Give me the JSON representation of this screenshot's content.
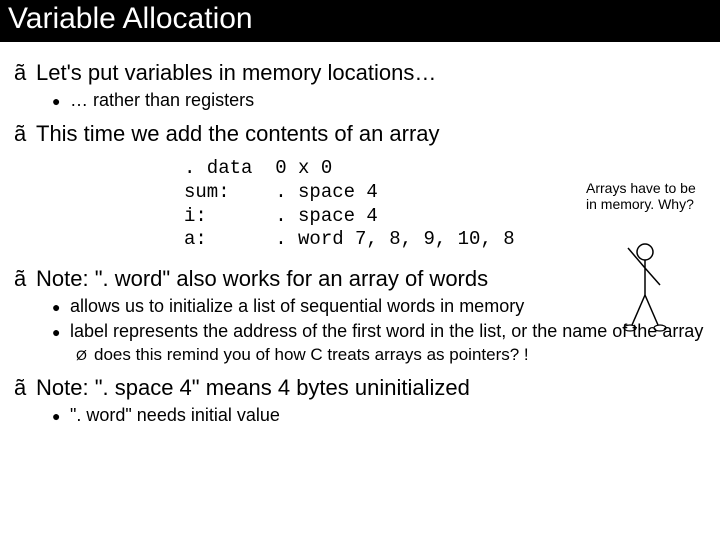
{
  "title": "Variable Allocation",
  "b1": {
    "text": "Let's put variables in memory locations…",
    "sub1": "… rather than registers"
  },
  "b2": {
    "text": "This time we add the contents of an array"
  },
  "code": ". data  0 x 0\nsum:    . space 4\ni:      . space 4\na:      . word 7, 8, 9, 10, 8",
  "annotation": "Arrays have to be in memory. Why?",
  "b3": {
    "text": "Note:  \". word\" also works for an array of words",
    "sub1": "allows us to initialize a list of sequential words in memory",
    "sub2": "label represents the address of the first word in the list, or the name of the array",
    "sub3": "does this remind you of how C treats arrays as pointers? !"
  },
  "b4": {
    "text": "Note:  \". space 4\" means 4 bytes uninitialized",
    "sub1": "\". word\" needs initial value"
  },
  "bullets": {
    "l1": "ã",
    "l2": "●",
    "l3": "Ø"
  }
}
